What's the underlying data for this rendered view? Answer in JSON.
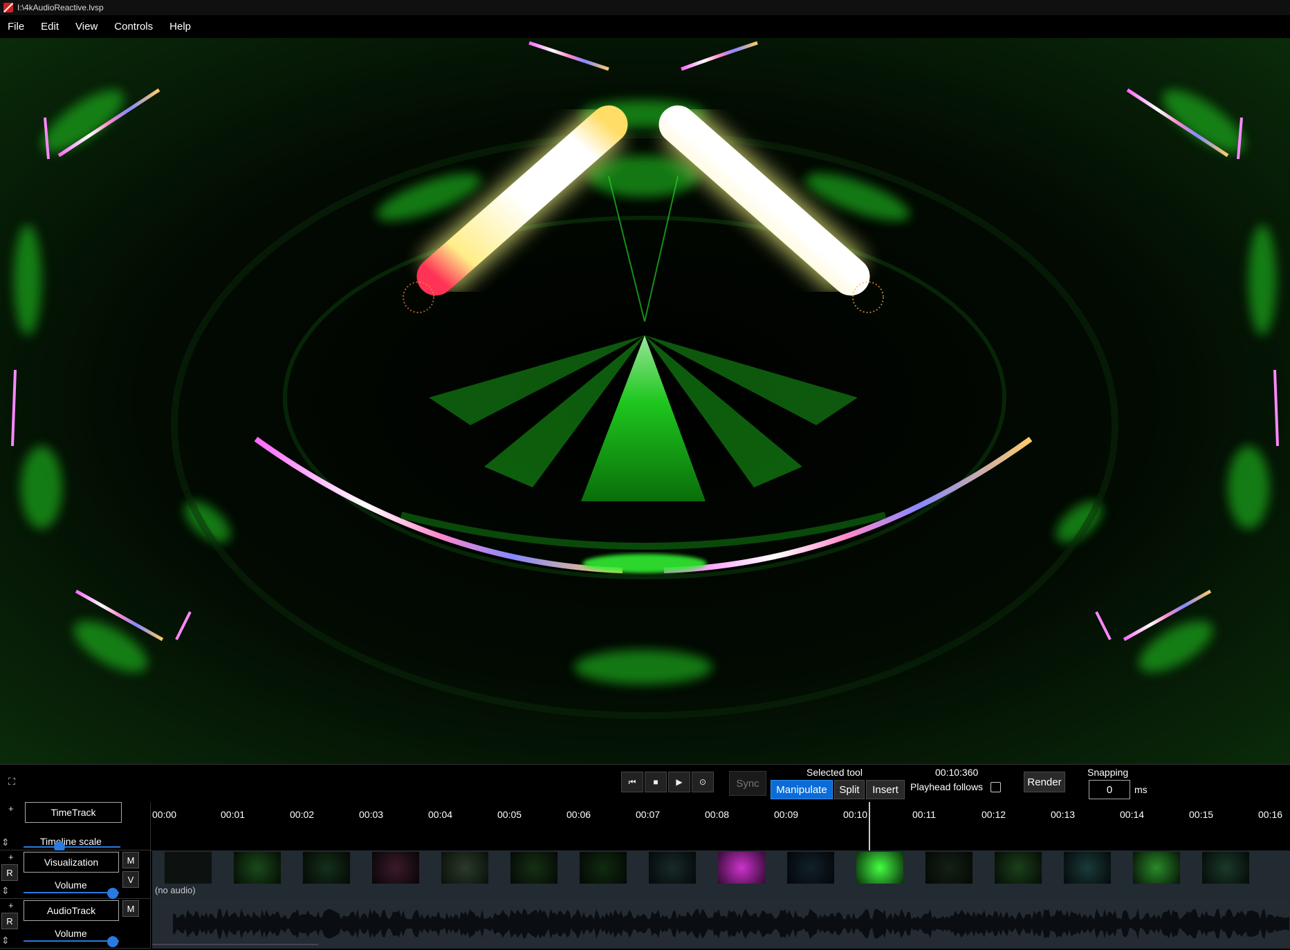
{
  "window": {
    "title": "I:\\4kAudioReactive.lvsp"
  },
  "menu": [
    "File",
    "Edit",
    "View",
    "Controls",
    "Help"
  ],
  "colors": {
    "accent": "#0a6cd8",
    "glow_green": "#22ff22",
    "panel": "#000000"
  },
  "transport": {
    "fullscreen_icon": "fullscreen-icon",
    "buttons": [
      {
        "name": "skip-start-button",
        "icon": "skip-back-icon",
        "glyph": "⏮"
      },
      {
        "name": "stop-button",
        "icon": "stop-icon",
        "glyph": "■"
      },
      {
        "name": "play-button",
        "icon": "play-icon",
        "glyph": "▶"
      },
      {
        "name": "record-button",
        "icon": "record-icon",
        "glyph": "⊙"
      }
    ],
    "sync_label": "Sync",
    "selected_tool_label": "Selected tool",
    "tools": [
      "Manipulate",
      "Split",
      "Insert"
    ],
    "active_tool": "Manipulate",
    "time_display": "00:10:360",
    "playhead_follows_label": "Playhead follows",
    "render_label": "Render",
    "snapping_label": "Snapping",
    "snapping_value": "0",
    "snapping_unit": "ms"
  },
  "timeline": {
    "ticks": [
      "00:00",
      "00:01",
      "00:02",
      "00:03",
      "00:04",
      "00:05",
      "00:06",
      "00:07",
      "00:08",
      "00:09",
      "00:10",
      "00:11",
      "00:12",
      "00:13",
      "00:14",
      "00:15",
      "00:16"
    ],
    "timetrack": {
      "name": "TimeTrack",
      "slider_label": "Timeline scale",
      "plus": "+"
    },
    "visualization": {
      "name": "Visualization",
      "m": "M",
      "v": "V",
      "r": "R",
      "slider_label": "Volume",
      "no_audio": "(no audio)",
      "volume_fraction": 1.0
    },
    "audio": {
      "name": "AudioTrack",
      "m": "M",
      "r": "R",
      "slider_label": "Volume",
      "volume_fraction": 1.0
    }
  }
}
